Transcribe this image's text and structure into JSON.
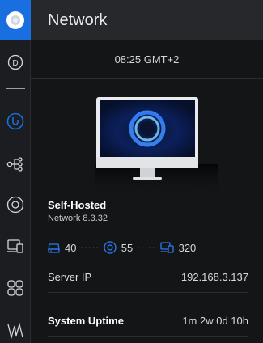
{
  "header": {
    "title": "Network"
  },
  "rail": {
    "items": [
      {
        "icon": "dashboard-icon"
      },
      {
        "icon": "ubiquiti-icon"
      },
      {
        "icon": "topology-icon"
      },
      {
        "icon": "devices-icon"
      },
      {
        "icon": "clients-icon"
      },
      {
        "icon": "applications-icon"
      },
      {
        "icon": "insights-icon"
      }
    ]
  },
  "clock": {
    "text": "08:25 GMT+2"
  },
  "console": {
    "name": "Self-Hosted",
    "subtitle": "Network 8.3.32"
  },
  "stats": {
    "devices": "40",
    "access_points": "55",
    "clients": "320"
  },
  "info": {
    "server_ip_label": "Server IP",
    "server_ip_value": "192.168.3.137",
    "uptime_label": "System Uptime",
    "uptime_value": "1m 2w 0d 10h"
  },
  "colors": {
    "accent": "#1a6fe0",
    "background": "#141517",
    "header": "#26282c"
  }
}
